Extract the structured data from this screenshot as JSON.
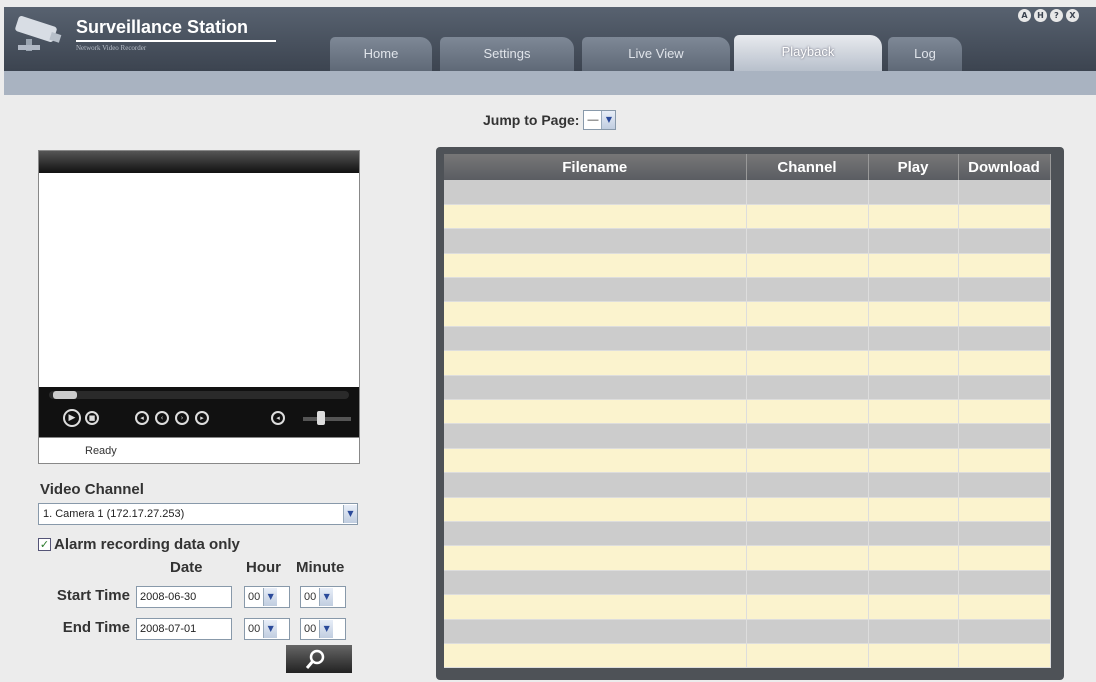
{
  "app": {
    "title": "Surveillance Station",
    "subtitle": "Network Video Recorder"
  },
  "top_icons": [
    "A",
    "H",
    "?",
    "X"
  ],
  "tabs": [
    {
      "label": "Home"
    },
    {
      "label": "Settings"
    },
    {
      "label": "Live View"
    },
    {
      "label": "Playback",
      "active": true
    },
    {
      "label": "Log"
    }
  ],
  "jump": {
    "label": "Jump to Page:",
    "value": "—"
  },
  "player": {
    "status": "Ready"
  },
  "form": {
    "video_channel_label": "Video Channel",
    "video_channel_value": "1. Camera 1 (172.17.27.253)",
    "alarm_label": "Alarm recording data only",
    "alarm_checked": true,
    "col_date": "Date",
    "col_hour": "Hour",
    "col_minute": "Minute",
    "start_label": "Start Time",
    "start_date": "2008-06-30",
    "start_hour": "00",
    "start_minute": "00",
    "end_label": "End Time",
    "end_date": "2008-07-01",
    "end_hour": "00",
    "end_minute": "00"
  },
  "table": {
    "headers": [
      "Filename",
      "Channel",
      "Play",
      "Download"
    ],
    "row_count": 20
  },
  "colors": {
    "header_bg": "#4a525e",
    "row_odd": "#cccccc",
    "row_even": "#fbf3ce",
    "table_frame": "#4e5257"
  }
}
